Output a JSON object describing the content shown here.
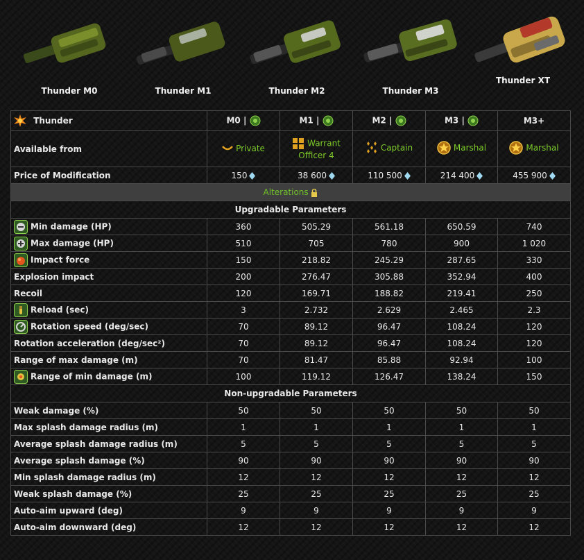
{
  "tanks": [
    {
      "name": "Thunder M0"
    },
    {
      "name": "Thunder M1"
    },
    {
      "name": "Thunder M2"
    },
    {
      "name": "Thunder M3"
    },
    {
      "name": "Thunder XT"
    }
  ],
  "table": {
    "title": "Thunder",
    "columns": [
      "M0 |",
      "M1 |",
      "M2 |",
      "M3 |",
      "M3+"
    ],
    "available_label": "Available from",
    "ranks": [
      "Private",
      "Warrant Officer 4",
      "Captain",
      "Marshal",
      "Marshal"
    ],
    "price_label": "Price of Modification",
    "prices": [
      "150",
      "38 600",
      "110 500",
      "214 400",
      "455 900"
    ],
    "alterations_label": "Alterations",
    "upgradable_label": "Upgradable Parameters",
    "upgradable": [
      {
        "label": "Min damage (HP)",
        "icon": "min-damage-icon",
        "values": [
          "360",
          "505.29",
          "561.18",
          "650.59",
          "740"
        ]
      },
      {
        "label": "Max damage (HP)",
        "icon": "max-damage-icon",
        "values": [
          "510",
          "705",
          "780",
          "900",
          "1 020"
        ]
      },
      {
        "label": "Impact force",
        "icon": "impact-force-icon",
        "values": [
          "150",
          "218.82",
          "245.29",
          "287.65",
          "330"
        ]
      },
      {
        "label": "Explosion impact",
        "icon": "",
        "values": [
          "200",
          "276.47",
          "305.88",
          "352.94",
          "400"
        ]
      },
      {
        "label": "Recoil",
        "icon": "",
        "values": [
          "120",
          "169.71",
          "188.82",
          "219.41",
          "250"
        ]
      },
      {
        "label": "Reload (sec)",
        "icon": "reload-icon",
        "values": [
          "3",
          "2.732",
          "2.629",
          "2.465",
          "2.3"
        ]
      },
      {
        "label": "Rotation speed (deg/sec)",
        "icon": "rotation-speed-icon",
        "values": [
          "70",
          "89.12",
          "96.47",
          "108.24",
          "120"
        ]
      },
      {
        "label": "Rotation acceleration (deg/sec²)",
        "icon": "",
        "values": [
          "70",
          "89.12",
          "96.47",
          "108.24",
          "120"
        ]
      },
      {
        "label": "Range of max damage (m)",
        "icon": "",
        "values": [
          "70",
          "81.47",
          "85.88",
          "92.94",
          "100"
        ]
      },
      {
        "label": "Range of min damage (m)",
        "icon": "range-min-damage-icon",
        "values": [
          "100",
          "119.12",
          "126.47",
          "138.24",
          "150"
        ]
      }
    ],
    "nonupgradable_label": "Non-upgradable Parameters",
    "nonupgradable": [
      {
        "label": "Weak damage (%)",
        "values": [
          "50",
          "50",
          "50",
          "50",
          "50"
        ]
      },
      {
        "label": "Max splash damage radius (m)",
        "values": [
          "1",
          "1",
          "1",
          "1",
          "1"
        ]
      },
      {
        "label": "Average splash damage radius (m)",
        "values": [
          "5",
          "5",
          "5",
          "5",
          "5"
        ]
      },
      {
        "label": "Average splash damage (%)",
        "values": [
          "90",
          "90",
          "90",
          "90",
          "90"
        ]
      },
      {
        "label": "Min splash damage radius (m)",
        "values": [
          "12",
          "12",
          "12",
          "12",
          "12"
        ]
      },
      {
        "label": "Weak splash damage (%)",
        "values": [
          "25",
          "25",
          "25",
          "25",
          "25"
        ]
      },
      {
        "label": "Auto-aim upward (deg)",
        "values": [
          "9",
          "9",
          "9",
          "9",
          "9"
        ]
      },
      {
        "label": "Auto-aim downward (deg)",
        "values": [
          "12",
          "12",
          "12",
          "12",
          "12"
        ]
      }
    ]
  },
  "colors": {
    "rank_text": "#7ecb2a",
    "accent": "#f08a1c",
    "border": "#4a4a4a"
  }
}
